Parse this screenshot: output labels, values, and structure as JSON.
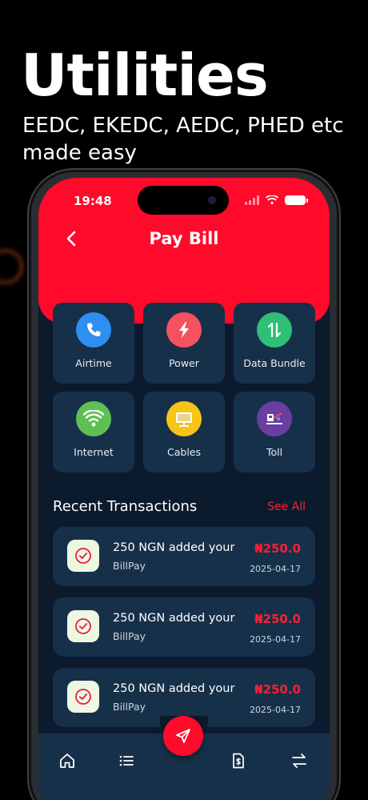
{
  "promo": {
    "headline": "Utilities",
    "subline": "EEDC, EKEDC, AEDC, PHED etc made easy"
  },
  "status_bar": {
    "time": "19:48"
  },
  "header": {
    "title": "Pay Bill",
    "back_icon": "chevron-left-icon"
  },
  "services": [
    {
      "label": "Airtime",
      "icon": "phone-icon",
      "color": "#2f8ff0"
    },
    {
      "label": "Power",
      "icon": "lightning-icon",
      "color": "#f4525e"
    },
    {
      "label": "Data Bundle",
      "icon": "arrows-updown-icon",
      "color": "#2fbf76"
    },
    {
      "label": "Internet",
      "icon": "wifi-icon",
      "color": "#5fbf54"
    },
    {
      "label": "Cables",
      "icon": "tv-icon",
      "color": "#f5c518"
    },
    {
      "label": "Toll",
      "icon": "toll-gate-icon",
      "color": "#6a3ea0"
    }
  ],
  "recent": {
    "title": "Recent Transactions",
    "see_all": "See All",
    "items": [
      {
        "title": "250 NGN added your",
        "sub": "BillPay",
        "amount": "₦250.0",
        "date": "2025-04-17"
      },
      {
        "title": "250 NGN added your",
        "sub": "BillPay",
        "amount": "₦250.0",
        "date": "2025-04-17"
      },
      {
        "title": "250 NGN added your",
        "sub": "BillPay",
        "amount": "₦250.0",
        "date": "2025-04-17"
      }
    ]
  },
  "navbar": {
    "items": [
      "home-icon",
      "list-icon",
      "document-icon",
      "transfer-icon"
    ],
    "fab_icon": "send-icon"
  },
  "colors": {
    "accent": "#ff0a2a",
    "background": "#0c1a2e",
    "card": "#16304a"
  }
}
